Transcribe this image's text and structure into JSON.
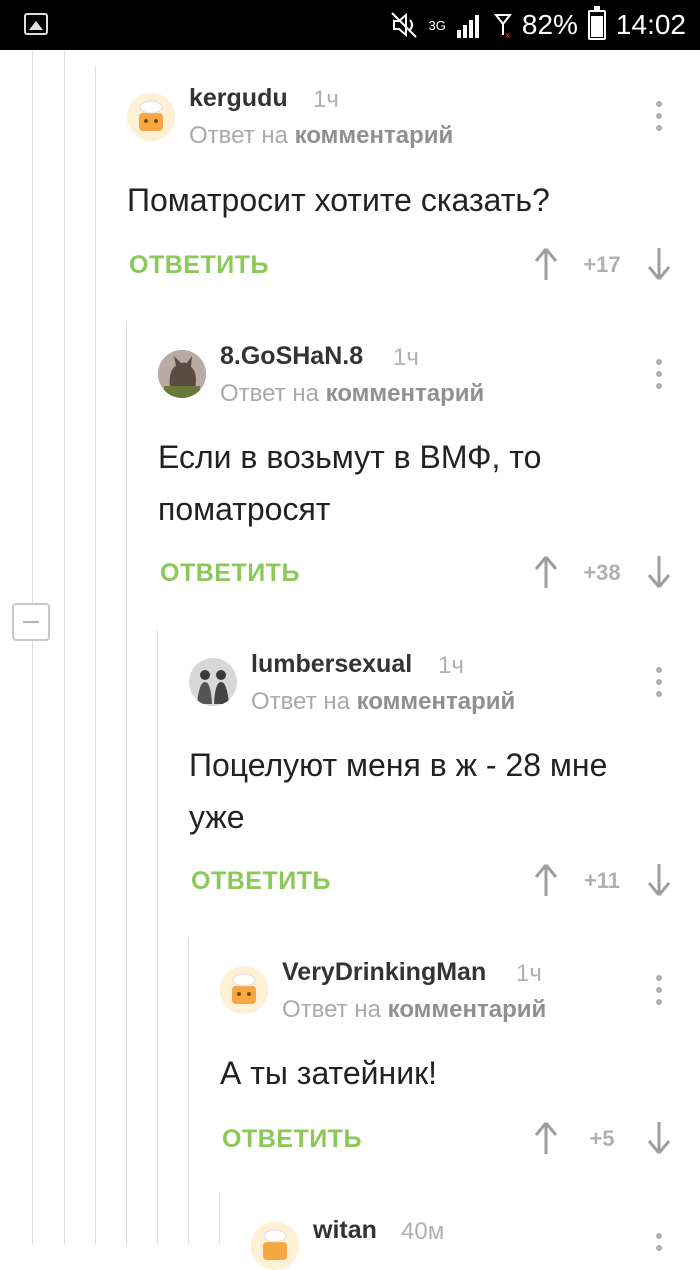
{
  "status_bar": {
    "network": "3G",
    "battery": "82%",
    "battery_level": 0.82,
    "time": "14:02"
  },
  "comments": [
    {
      "author": "kergudu",
      "time": "1ч",
      "reply_prefix": "Ответ на",
      "reply_target": "комментарий",
      "text": "Поматросит хотите сказать?",
      "reply_label": "ОТВЕТИТЬ",
      "score": "+17",
      "avatar": "cake-avatar"
    },
    {
      "author": "8.GoSHaN.8",
      "time": "1ч",
      "reply_prefix": "Ответ на",
      "reply_target": "комментарий",
      "text": "Если в возьмут в ВМФ, то поматросят",
      "reply_label": "ОТВЕТИТЬ",
      "score": "+38",
      "avatar": "cat-avatar"
    },
    {
      "author": "lumbersexual",
      "time": "1ч",
      "reply_prefix": "Ответ на",
      "reply_target": "комментарий",
      "text": "Поцелуют меня в ж - 28 мне уже",
      "reply_label": "ОТВЕТИТЬ",
      "score": "+11",
      "avatar": "photo-avatar"
    },
    {
      "author": "VeryDrinkingMan",
      "time": "1ч",
      "reply_prefix": "Ответ на",
      "reply_target": "комментарий",
      "text": "А ты затейник!",
      "reply_label": "ОТВЕТИТЬ",
      "score": "+5",
      "avatar": "cake-avatar"
    },
    {
      "author": "witan",
      "time": "40м",
      "avatar": "cake-avatar"
    }
  ],
  "colors": {
    "accent_green": "#8ac858",
    "muted_gray": "#b0b0b0",
    "text_dark": "#222222"
  }
}
